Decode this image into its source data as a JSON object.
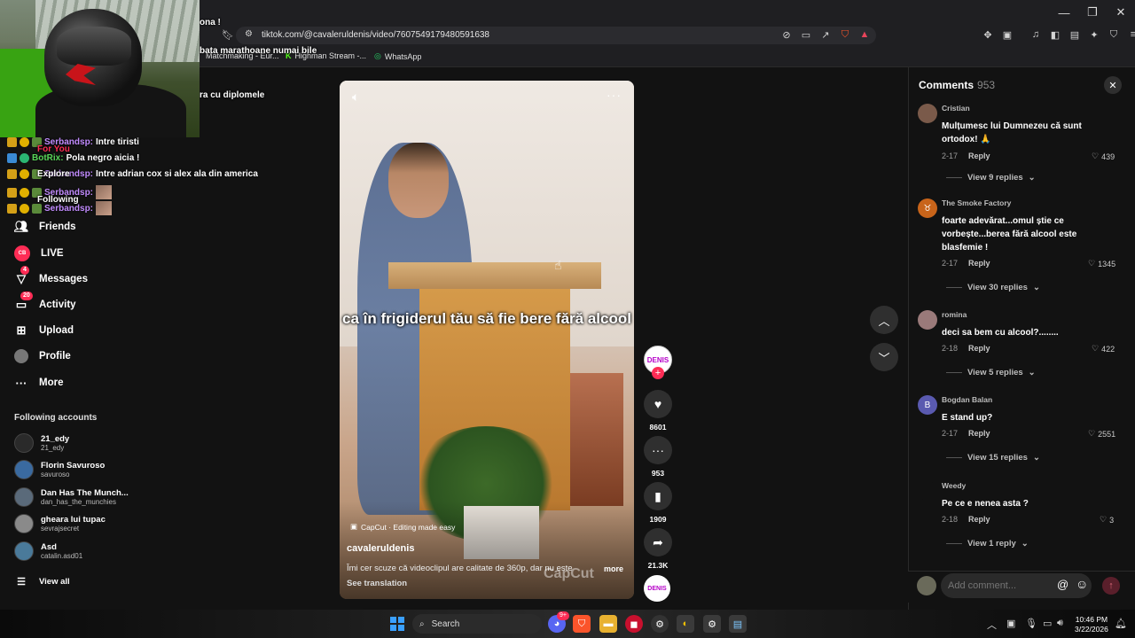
{
  "browser": {
    "url": "tiktok.com/@cavaleruldenis/video/7607549179480591638",
    "bookmarks": [
      "Matchmaking - Eur...",
      "Highman Stream -...",
      "WhatsApp"
    ],
    "window_controls": [
      "—",
      "❐",
      "✕"
    ]
  },
  "overlay": {
    "line1": "ona !",
    "line2": "bata marathoane numai bile",
    "line3": "ra cu diplomele",
    "for_you": "For You",
    "explore": "Explore",
    "following": "Following"
  },
  "chat": [
    {
      "user": "Serbandsp:",
      "msg": "Intre tiristi"
    },
    {
      "user": "BotRix:",
      "msg": "Pola negro aicia !"
    },
    {
      "user": "Serbandsp:",
      "msg": "Intre adrian cox si alex ala din america"
    },
    {
      "user": "Serbandsp:",
      "msg": ""
    },
    {
      "user": "Serbandsp:",
      "msg": ""
    }
  ],
  "nav": {
    "friends": "Friends",
    "live": "LIVE",
    "messages": "Messages",
    "messages_badge": "4",
    "activity": "Activity",
    "activity_badge": "20",
    "upload": "Upload",
    "profile": "Profile",
    "more": "More"
  },
  "following_title": "Following accounts",
  "accounts": [
    {
      "name": "21_edy",
      "handle": "21_edy"
    },
    {
      "name": "Florin Savuroso",
      "handle": "savuroso"
    },
    {
      "name": "Dan Has The Munch...",
      "handle": "dan_has_the_munchies"
    },
    {
      "name": "gheara lui tupac",
      "handle": "sevrajsecret"
    },
    {
      "name": "Asd",
      "handle": "catalin.asd01"
    }
  ],
  "view_all": "View all",
  "video": {
    "caption": "ca în frigiderul tău să fie bere fără alcool",
    "capcut_tag": "CapCut · Editing made easy",
    "author": "cavaleruldenis",
    "description": "Îmi cer scuze că videoclipul are calitate de 360p, dar nu este",
    "more": "more",
    "see_translation": "See translation",
    "watermark": "CapCut",
    "avatar_text": "DENIS"
  },
  "actions": {
    "likes": "8601",
    "comments": "953",
    "saves": "1909",
    "shares": "21.3K"
  },
  "comments": {
    "title": "Comments",
    "count": "953",
    "items": [
      {
        "user": "Cristian",
        "text": "Mulțumesc lui Dumnezeu că sunt ortodox! 🙏",
        "date": "2-17",
        "likes": "439",
        "replies": "View 9 replies"
      },
      {
        "user": "The Smoke Factory",
        "text": "foarte adevărat...omul știe ce vorbește...berea fără alcool este blasfemie !",
        "date": "2-17",
        "likes": "1345",
        "replies": "View 30 replies"
      },
      {
        "user": "romina",
        "text": "deci sa bem cu alcool?........",
        "date": "2-18",
        "likes": "422",
        "replies": "View 5 replies"
      },
      {
        "user": "Bogdan Balan",
        "text": "E stand up?",
        "date": "2-17",
        "likes": "2551",
        "replies": "View 15 replies"
      },
      {
        "user": "Weedy",
        "text": "Pe ce e nenea asta ?",
        "date": "2-18",
        "likes": "3",
        "replies": "View 1 reply"
      }
    ],
    "reply_label": "Reply",
    "input_placeholder": "Add comment..."
  },
  "taskbar": {
    "search": "Search",
    "time": "10:46 PM",
    "date": "3/22/2026",
    "discord_badge": "9+"
  }
}
